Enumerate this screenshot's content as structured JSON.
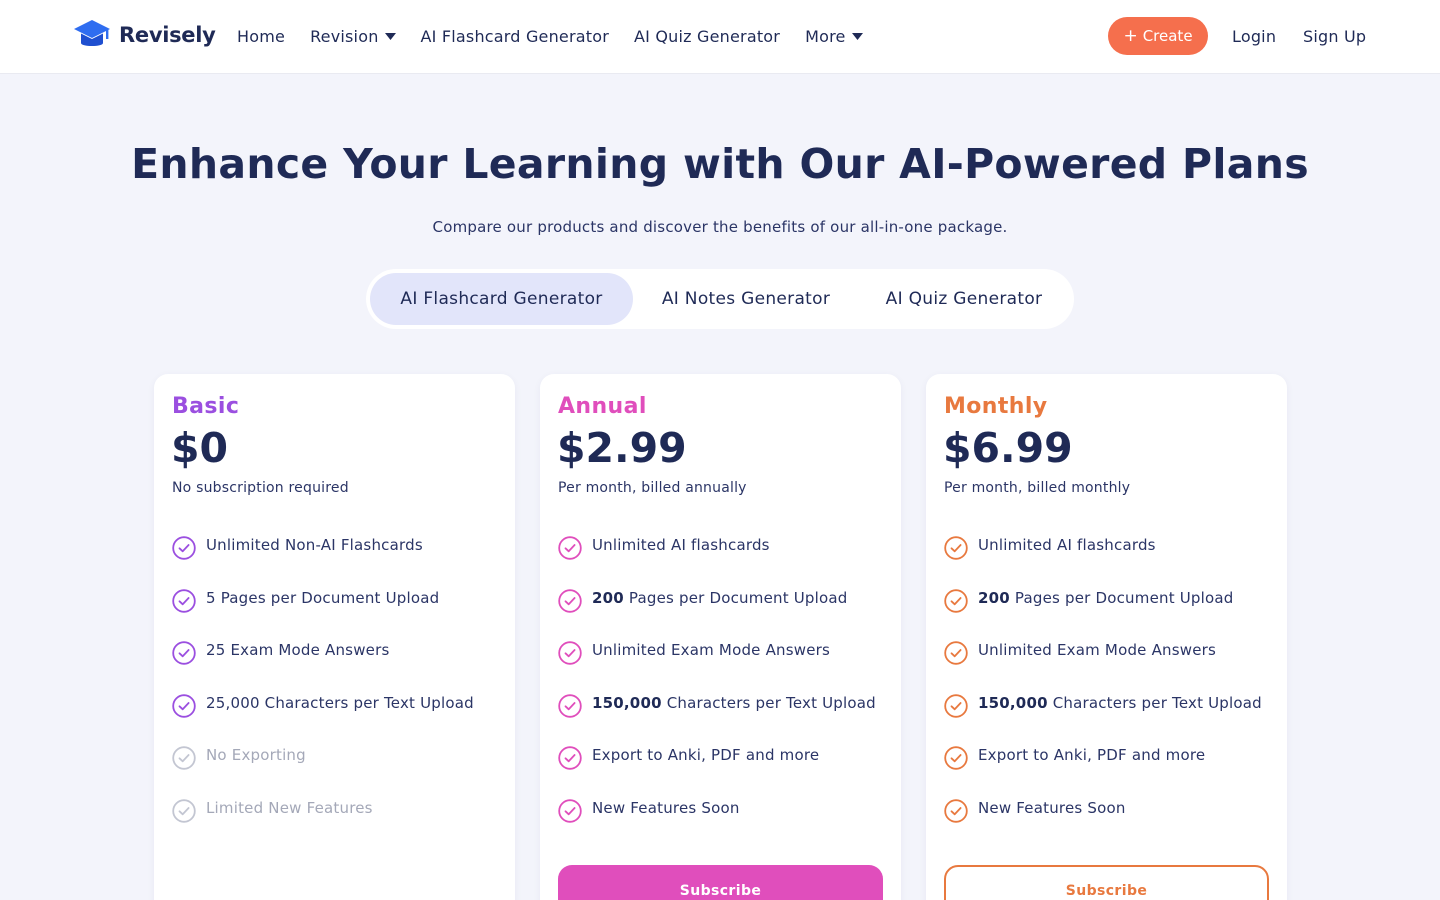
{
  "header": {
    "brand": "Revisely",
    "nav": [
      {
        "label": "Home",
        "dropdown": false
      },
      {
        "label": "Revision",
        "dropdown": true
      },
      {
        "label": "AI Flashcard Generator",
        "dropdown": false
      },
      {
        "label": "AI Quiz Generator",
        "dropdown": false
      },
      {
        "label": "More",
        "dropdown": true
      }
    ],
    "create_label": "Create",
    "login_label": "Login",
    "signup_label": "Sign Up"
  },
  "hero": {
    "title": "Enhance Your Learning with Our AI-Powered Plans",
    "subtitle": "Compare our products and discover the benefits of our all-in-one package."
  },
  "tabs": [
    {
      "label": "AI Flashcard Generator",
      "active": true
    },
    {
      "label": "AI Notes Generator",
      "active": false
    },
    {
      "label": "AI Quiz Generator",
      "active": false
    }
  ],
  "colors": {
    "navy": "#1f2a56",
    "create": "#f56f4d",
    "basic": "#9b4fe0",
    "annual": "#e04ebc",
    "monthly": "#e8793f",
    "muted": "#c3c6d2"
  },
  "plans": [
    {
      "name": "Basic",
      "price": "$0",
      "note": "No subscription required",
      "features": [
        {
          "pre": "",
          "bold": "",
          "text": "Unlimited Non-AI Flashcards",
          "muted": false
        },
        {
          "pre": "",
          "bold": "",
          "text": "5 Pages per Document Upload",
          "muted": false
        },
        {
          "pre": "",
          "bold": "",
          "text": "25 Exam Mode Answers",
          "muted": false
        },
        {
          "pre": "",
          "bold": "",
          "text": "25,000 Characters per Text Upload",
          "muted": false
        },
        {
          "pre": "",
          "bold": "",
          "text": "No Exporting",
          "muted": true
        },
        {
          "pre": "",
          "bold": "",
          "text": "Limited New Features",
          "muted": true
        }
      ]
    },
    {
      "name": "Annual",
      "price": "$2.99",
      "note": "Per month, billed annually",
      "subscribe_label": "Subscribe",
      "features": [
        {
          "bold": "",
          "text": "Unlimited AI flashcards",
          "muted": false
        },
        {
          "bold": "200",
          "text": " Pages per Document Upload",
          "muted": false
        },
        {
          "bold": "",
          "text": "Unlimited Exam Mode Answers",
          "muted": false
        },
        {
          "bold": "150,000",
          "text": " Characters per Text Upload",
          "muted": false
        },
        {
          "bold": "",
          "text": "Export to Anki, PDF and more",
          "muted": false
        },
        {
          "bold": "",
          "text": "New Features Soon",
          "muted": false
        }
      ]
    },
    {
      "name": "Monthly",
      "price": "$6.99",
      "note": "Per month, billed monthly",
      "subscribe_label": "Subscribe",
      "features": [
        {
          "bold": "",
          "text": "Unlimited AI flashcards",
          "muted": false
        },
        {
          "bold": "200",
          "text": " Pages per Document Upload",
          "muted": false
        },
        {
          "bold": "",
          "text": "Unlimited Exam Mode Answers",
          "muted": false
        },
        {
          "bold": "150,000",
          "text": " Characters per Text Upload",
          "muted": false
        },
        {
          "bold": "",
          "text": "Export to Anki, PDF and more",
          "muted": false
        },
        {
          "bold": "",
          "text": "New Features Soon",
          "muted": false
        }
      ]
    }
  ]
}
